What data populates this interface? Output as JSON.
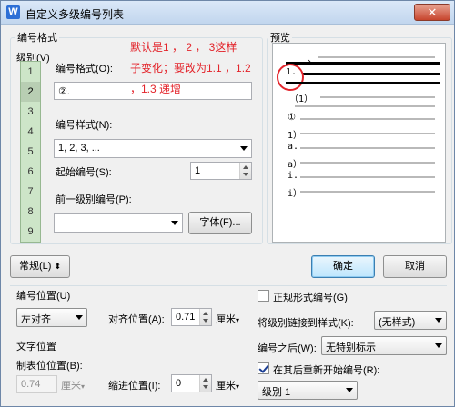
{
  "title": "自定义多级编号列表",
  "number_format_group": {
    "title": "编号格式",
    "level_label": "级别(V)",
    "levels": [
      "1",
      "2",
      "3",
      "4",
      "5",
      "6",
      "7",
      "8",
      "9"
    ],
    "selected_level": "2",
    "format_label": "编号格式(O):",
    "format_value": "②.",
    "style_label": "编号样式(N):",
    "style_value": "1, 2, 3, ...",
    "start_label": "起始编号(S):",
    "start_value": "1",
    "prev_level_label": "前一级别编号(P):",
    "prev_level_value": "",
    "font_button": "字体(F)..."
  },
  "annotation": {
    "line1": "默认是1  ，  2   ，  3这样",
    "line2": "子变化；要改为1.1   ，1.2",
    "line3": "，1.3   递增"
  },
  "preview": {
    "title": "预览",
    "items": [
      "、",
      "1.",
      "（1）",
      "①",
      "1）",
      "a.",
      "a）",
      "i.",
      "i）"
    ]
  },
  "buttons": {
    "normal": "常规(L)",
    "ok": "确定",
    "cancel": "取消"
  },
  "number_position": {
    "title": "编号位置(U)",
    "align_value": "左对齐",
    "align_pos_label": "对齐位置(A):",
    "align_pos_value": "0.71",
    "align_pos_unit": "厘米"
  },
  "text_position": {
    "title": "文字位置",
    "tab_label": "制表位位置(B):",
    "tab_value": "0.74",
    "tab_unit": "厘米",
    "indent_label": "缩进位置(I):",
    "indent_value": "0",
    "indent_unit": "厘米"
  },
  "right_options": {
    "legal_label": "正规形式编号(G)",
    "legal_checked": false,
    "link_style_label": "将级别链接到样式(K):",
    "link_style_value": "(无样式)",
    "after_label": "编号之后(W):",
    "after_value": "无特别标示",
    "restart_label": "在其后重新开始编号(R):",
    "restart_checked": true,
    "restart_value": "级别 1"
  }
}
